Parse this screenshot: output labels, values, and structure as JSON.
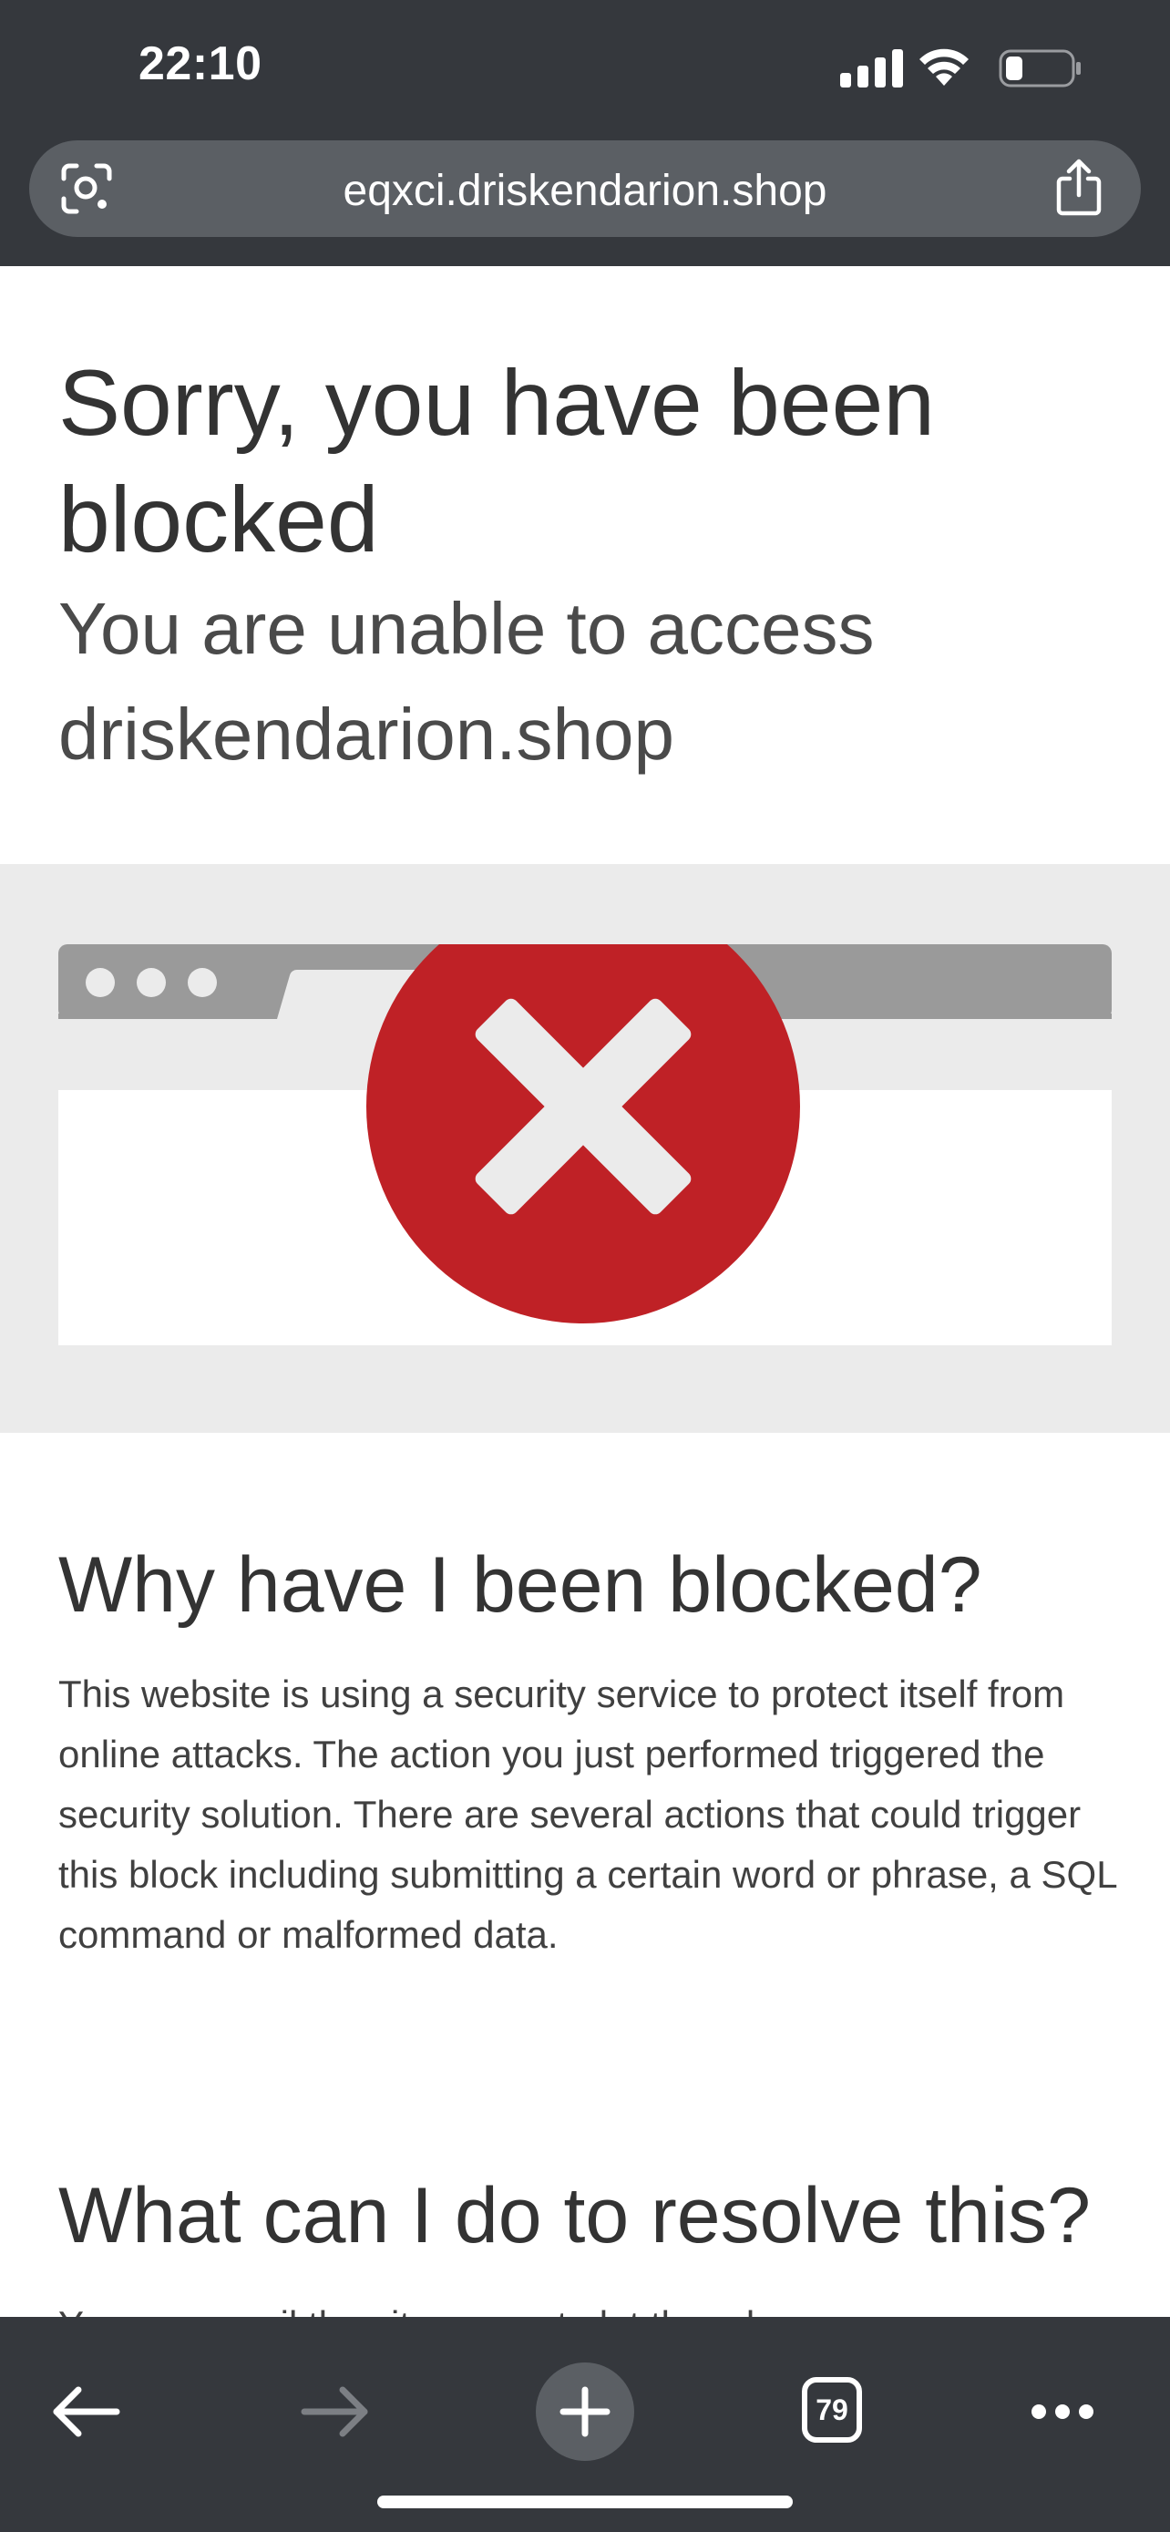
{
  "status_bar": {
    "time": "22:10"
  },
  "browser": {
    "url": "eqxci.driskendarion.shop",
    "tab_count": "79"
  },
  "page": {
    "title": "Sorry, you have been blocked",
    "subtitle": "You are unable to access driskendarion.shop",
    "why_heading": "Why have I been blocked?",
    "why_text": "This website is using a security service to protect itself from online attacks. The action you just performed triggered the security solution. There are several actions that could trigger this block including submitting a certain word or phrase, a SQL command or malformed data.",
    "resolve_heading": "What can I do to resolve this?",
    "resolve_text": "You can email the site owner to let them know you were blocked."
  },
  "colors": {
    "chrome_bg": "#35383d",
    "error_red": "#bf2126",
    "band_gray": "#ebebeb"
  },
  "icons": [
    "lens-icon",
    "share-icon",
    "back-arrow-icon",
    "forward-arrow-icon",
    "plus-icon",
    "tabs-icon",
    "more-icon",
    "error-x-icon"
  ]
}
